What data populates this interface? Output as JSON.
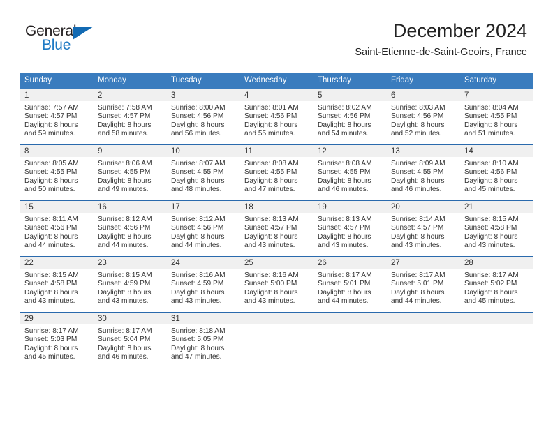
{
  "brand": {
    "name_top": "General",
    "name_bottom": "Blue",
    "accent_color": "#126ab3",
    "dark_color": "#231f20"
  },
  "header": {
    "title": "December 2024",
    "subtitle": "Saint-Etienne-de-Saint-Geoirs, France"
  },
  "theme": {
    "header_row_bg": "#3a7cbe",
    "header_row_text": "#ffffff",
    "daynum_band_bg": "#f0f0f0",
    "cell_border": "#2a6aad"
  },
  "weekday_headers": [
    "Sunday",
    "Monday",
    "Tuesday",
    "Wednesday",
    "Thursday",
    "Friday",
    "Saturday"
  ],
  "weeks": [
    [
      {
        "day": "1",
        "sunrise": "Sunrise: 7:57 AM",
        "sunset": "Sunset: 4:57 PM",
        "daylight_1": "Daylight: 8 hours",
        "daylight_2": "and 59 minutes."
      },
      {
        "day": "2",
        "sunrise": "Sunrise: 7:58 AM",
        "sunset": "Sunset: 4:57 PM",
        "daylight_1": "Daylight: 8 hours",
        "daylight_2": "and 58 minutes."
      },
      {
        "day": "3",
        "sunrise": "Sunrise: 8:00 AM",
        "sunset": "Sunset: 4:56 PM",
        "daylight_1": "Daylight: 8 hours",
        "daylight_2": "and 56 minutes."
      },
      {
        "day": "4",
        "sunrise": "Sunrise: 8:01 AM",
        "sunset": "Sunset: 4:56 PM",
        "daylight_1": "Daylight: 8 hours",
        "daylight_2": "and 55 minutes."
      },
      {
        "day": "5",
        "sunrise": "Sunrise: 8:02 AM",
        "sunset": "Sunset: 4:56 PM",
        "daylight_1": "Daylight: 8 hours",
        "daylight_2": "and 54 minutes."
      },
      {
        "day": "6",
        "sunrise": "Sunrise: 8:03 AM",
        "sunset": "Sunset: 4:56 PM",
        "daylight_1": "Daylight: 8 hours",
        "daylight_2": "and 52 minutes."
      },
      {
        "day": "7",
        "sunrise": "Sunrise: 8:04 AM",
        "sunset": "Sunset: 4:55 PM",
        "daylight_1": "Daylight: 8 hours",
        "daylight_2": "and 51 minutes."
      }
    ],
    [
      {
        "day": "8",
        "sunrise": "Sunrise: 8:05 AM",
        "sunset": "Sunset: 4:55 PM",
        "daylight_1": "Daylight: 8 hours",
        "daylight_2": "and 50 minutes."
      },
      {
        "day": "9",
        "sunrise": "Sunrise: 8:06 AM",
        "sunset": "Sunset: 4:55 PM",
        "daylight_1": "Daylight: 8 hours",
        "daylight_2": "and 49 minutes."
      },
      {
        "day": "10",
        "sunrise": "Sunrise: 8:07 AM",
        "sunset": "Sunset: 4:55 PM",
        "daylight_1": "Daylight: 8 hours",
        "daylight_2": "and 48 minutes."
      },
      {
        "day": "11",
        "sunrise": "Sunrise: 8:08 AM",
        "sunset": "Sunset: 4:55 PM",
        "daylight_1": "Daylight: 8 hours",
        "daylight_2": "and 47 minutes."
      },
      {
        "day": "12",
        "sunrise": "Sunrise: 8:08 AM",
        "sunset": "Sunset: 4:55 PM",
        "daylight_1": "Daylight: 8 hours",
        "daylight_2": "and 46 minutes."
      },
      {
        "day": "13",
        "sunrise": "Sunrise: 8:09 AM",
        "sunset": "Sunset: 4:55 PM",
        "daylight_1": "Daylight: 8 hours",
        "daylight_2": "and 46 minutes."
      },
      {
        "day": "14",
        "sunrise": "Sunrise: 8:10 AM",
        "sunset": "Sunset: 4:56 PM",
        "daylight_1": "Daylight: 8 hours",
        "daylight_2": "and 45 minutes."
      }
    ],
    [
      {
        "day": "15",
        "sunrise": "Sunrise: 8:11 AM",
        "sunset": "Sunset: 4:56 PM",
        "daylight_1": "Daylight: 8 hours",
        "daylight_2": "and 44 minutes."
      },
      {
        "day": "16",
        "sunrise": "Sunrise: 8:12 AM",
        "sunset": "Sunset: 4:56 PM",
        "daylight_1": "Daylight: 8 hours",
        "daylight_2": "and 44 minutes."
      },
      {
        "day": "17",
        "sunrise": "Sunrise: 8:12 AM",
        "sunset": "Sunset: 4:56 PM",
        "daylight_1": "Daylight: 8 hours",
        "daylight_2": "and 44 minutes."
      },
      {
        "day": "18",
        "sunrise": "Sunrise: 8:13 AM",
        "sunset": "Sunset: 4:57 PM",
        "daylight_1": "Daylight: 8 hours",
        "daylight_2": "and 43 minutes."
      },
      {
        "day": "19",
        "sunrise": "Sunrise: 8:13 AM",
        "sunset": "Sunset: 4:57 PM",
        "daylight_1": "Daylight: 8 hours",
        "daylight_2": "and 43 minutes."
      },
      {
        "day": "20",
        "sunrise": "Sunrise: 8:14 AM",
        "sunset": "Sunset: 4:57 PM",
        "daylight_1": "Daylight: 8 hours",
        "daylight_2": "and 43 minutes."
      },
      {
        "day": "21",
        "sunrise": "Sunrise: 8:15 AM",
        "sunset": "Sunset: 4:58 PM",
        "daylight_1": "Daylight: 8 hours",
        "daylight_2": "and 43 minutes."
      }
    ],
    [
      {
        "day": "22",
        "sunrise": "Sunrise: 8:15 AM",
        "sunset": "Sunset: 4:58 PM",
        "daylight_1": "Daylight: 8 hours",
        "daylight_2": "and 43 minutes."
      },
      {
        "day": "23",
        "sunrise": "Sunrise: 8:15 AM",
        "sunset": "Sunset: 4:59 PM",
        "daylight_1": "Daylight: 8 hours",
        "daylight_2": "and 43 minutes."
      },
      {
        "day": "24",
        "sunrise": "Sunrise: 8:16 AM",
        "sunset": "Sunset: 4:59 PM",
        "daylight_1": "Daylight: 8 hours",
        "daylight_2": "and 43 minutes."
      },
      {
        "day": "25",
        "sunrise": "Sunrise: 8:16 AM",
        "sunset": "Sunset: 5:00 PM",
        "daylight_1": "Daylight: 8 hours",
        "daylight_2": "and 43 minutes."
      },
      {
        "day": "26",
        "sunrise": "Sunrise: 8:17 AM",
        "sunset": "Sunset: 5:01 PM",
        "daylight_1": "Daylight: 8 hours",
        "daylight_2": "and 44 minutes."
      },
      {
        "day": "27",
        "sunrise": "Sunrise: 8:17 AM",
        "sunset": "Sunset: 5:01 PM",
        "daylight_1": "Daylight: 8 hours",
        "daylight_2": "and 44 minutes."
      },
      {
        "day": "28",
        "sunrise": "Sunrise: 8:17 AM",
        "sunset": "Sunset: 5:02 PM",
        "daylight_1": "Daylight: 8 hours",
        "daylight_2": "and 45 minutes."
      }
    ],
    [
      {
        "day": "29",
        "sunrise": "Sunrise: 8:17 AM",
        "sunset": "Sunset: 5:03 PM",
        "daylight_1": "Daylight: 8 hours",
        "daylight_2": "and 45 minutes."
      },
      {
        "day": "30",
        "sunrise": "Sunrise: 8:17 AM",
        "sunset": "Sunset: 5:04 PM",
        "daylight_1": "Daylight: 8 hours",
        "daylight_2": "and 46 minutes."
      },
      {
        "day": "31",
        "sunrise": "Sunrise: 8:18 AM",
        "sunset": "Sunset: 5:05 PM",
        "daylight_1": "Daylight: 8 hours",
        "daylight_2": "and 47 minutes."
      },
      {
        "day": "",
        "sunrise": "",
        "sunset": "",
        "daylight_1": "",
        "daylight_2": ""
      },
      {
        "day": "",
        "sunrise": "",
        "sunset": "",
        "daylight_1": "",
        "daylight_2": ""
      },
      {
        "day": "",
        "sunrise": "",
        "sunset": "",
        "daylight_1": "",
        "daylight_2": ""
      },
      {
        "day": "",
        "sunrise": "",
        "sunset": "",
        "daylight_1": "",
        "daylight_2": ""
      }
    ]
  ]
}
